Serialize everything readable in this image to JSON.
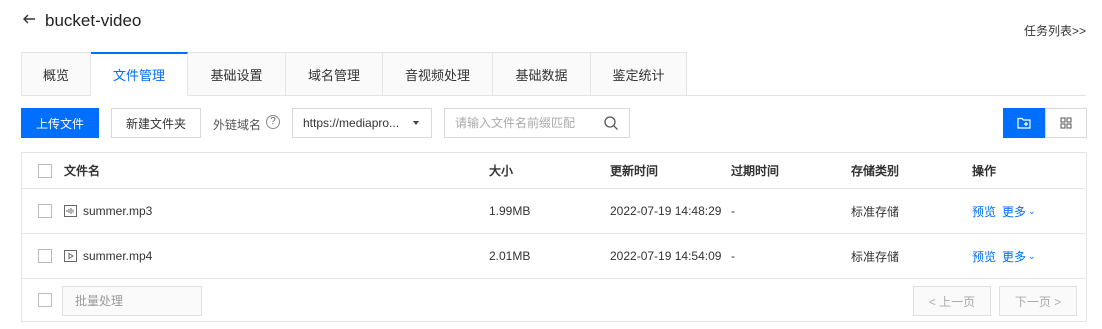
{
  "header": {
    "title": "bucket-video",
    "task_list": "任务列表>>"
  },
  "tabs": [
    {
      "label": "概览",
      "active": false
    },
    {
      "label": "文件管理",
      "active": true
    },
    {
      "label": "基础设置",
      "active": false
    },
    {
      "label": "域名管理",
      "active": false
    },
    {
      "label": "音视频处理",
      "active": false
    },
    {
      "label": "基础数据",
      "active": false
    },
    {
      "label": "鉴定统计",
      "active": false
    }
  ],
  "toolbar": {
    "upload_label": "上传文件",
    "new_folder_label": "新建文件夹",
    "domain_label": "外链域名",
    "help_glyph": "?",
    "domain_value": "https://mediapro...",
    "search_placeholder": "请输入文件名前缀匹配"
  },
  "table": {
    "columns": [
      "文件名",
      "大小",
      "更新时间",
      "过期时间",
      "存储类别",
      "操作"
    ],
    "rows": [
      {
        "name": "summer.mp3",
        "icon": "audio-file-icon",
        "size": "1.99MB",
        "updated": "2022-07-19 14:48:29",
        "expires": "-",
        "storage": "标准存储",
        "preview": "预览",
        "more": "更多"
      },
      {
        "name": "summer.mp4",
        "icon": "video-file-icon",
        "size": "2.01MB",
        "updated": "2022-07-19 14:54:09",
        "expires": "-",
        "storage": "标准存储",
        "preview": "预览",
        "more": "更多"
      }
    ]
  },
  "footer": {
    "batch_label": "批量处理",
    "prev_label": "< 上一页",
    "next_label": "下一页 >"
  },
  "colors": {
    "accent": "#006eff",
    "border": "#e5e5e5"
  }
}
